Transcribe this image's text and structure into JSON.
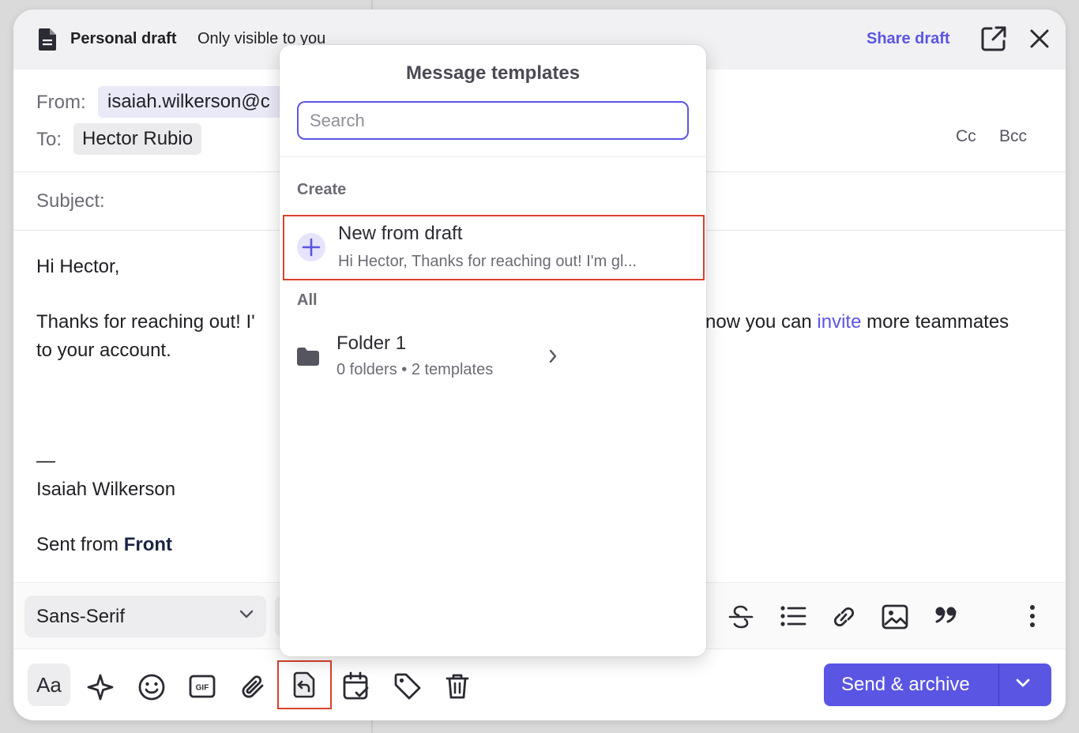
{
  "header": {
    "title": "Personal draft",
    "subtitle": "Only visible to you",
    "share_label": "Share draft"
  },
  "fields": {
    "from_label": "From:",
    "from_value": "isaiah.wilkerson@c",
    "to_label": "To:",
    "to_value": "Hector Rubio",
    "cc_label": "Cc",
    "bcc_label": "Bcc",
    "subject_label": "Subject:"
  },
  "body": {
    "greeting": "Hi Hector,",
    "para_start": "Thanks for reaching out! I'",
    "para_mid": "now you can ",
    "link": "invite",
    "para_end": " more teammates",
    "para_line2": "to your account.",
    "dash": "—",
    "signature_name": "Isaiah Wilkerson",
    "sent_from": "Sent from ",
    "sent_brand": "Front"
  },
  "toolbar": {
    "font_family": "Sans-Serif",
    "aa_label": "Aa",
    "send_label": "Send & archive"
  },
  "templates": {
    "title": "Message templates",
    "search_placeholder": "Search",
    "create_label": "Create",
    "new_title": "New from draft",
    "new_preview": "Hi Hector, Thanks for reaching out! I'm gl...",
    "all_label": "All",
    "folder_name": "Folder 1",
    "folder_meta": "0 folders • 2 templates"
  },
  "colors": {
    "accent": "#5b55e3",
    "highlight": "#d8412d"
  }
}
